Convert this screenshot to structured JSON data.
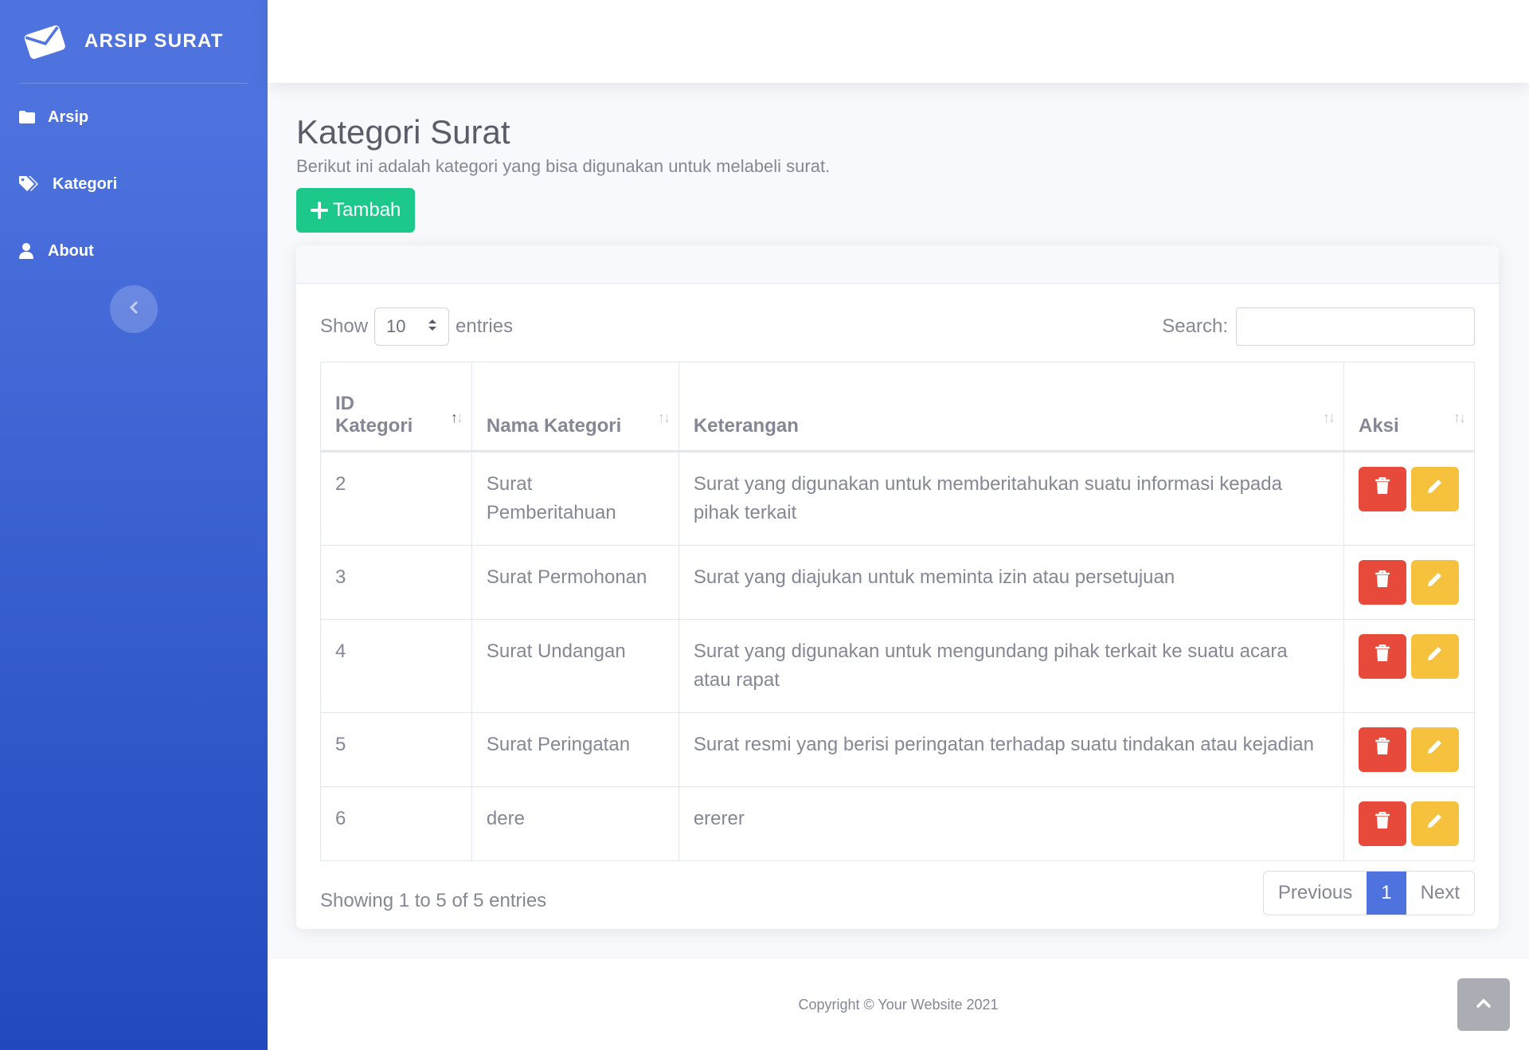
{
  "app": {
    "brand": "ARSIP SURAT"
  },
  "sidebar": {
    "items": [
      {
        "label": "Arsip",
        "icon": "folder-icon"
      },
      {
        "label": "Kategori",
        "icon": "tags-icon"
      },
      {
        "label": "About",
        "icon": "user-icon"
      }
    ],
    "toggle_icon": "chevron-left-icon"
  },
  "page": {
    "title": "Kategori Surat",
    "subtitle": "Berikut ini adalah kategori yang bisa digunakan untuk melabeli surat.",
    "add_button": "Tambah"
  },
  "table_controls": {
    "show_label": "Show",
    "entries_value": "10",
    "entries_label": "entries",
    "search_label": "Search:",
    "search_value": ""
  },
  "table": {
    "columns": [
      {
        "line1": "ID",
        "line2": "Kategori"
      },
      {
        "line1": "",
        "line2": "Nama Kategori"
      },
      {
        "line1": "",
        "line2": "Keterangan"
      },
      {
        "line1": "",
        "line2": "Aksi"
      }
    ],
    "rows": [
      {
        "id": "2",
        "nama": "Surat Pemberitahuan",
        "keterangan": "Surat yang digunakan untuk memberitahukan suatu informasi kepada pihak terkait"
      },
      {
        "id": "3",
        "nama": "Surat Permohonan",
        "keterangan": "Surat yang diajukan untuk meminta izin atau persetujuan"
      },
      {
        "id": "4",
        "nama": "Surat Undangan",
        "keterangan": "Surat yang digunakan untuk mengundang pihak terkait ke suatu acara atau rapat"
      },
      {
        "id": "5",
        "nama": "Surat Peringatan",
        "keterangan": "Surat resmi yang berisi peringatan terhadap suatu tindakan atau kejadian"
      },
      {
        "id": "6",
        "nama": "dere",
        "keterangan": "ererer"
      }
    ]
  },
  "pagination": {
    "info": "Showing 1 to 5 of 5 entries",
    "previous": "Previous",
    "current": "1",
    "next": "Next"
  },
  "footer": {
    "copyright": "Copyright © Your Website 2021"
  },
  "colors": {
    "sidebar_top": "#4e73df",
    "sidebar_bottom": "#224abe",
    "success": "#1cc88a",
    "danger": "#e74a3b",
    "warning": "#f6c23e",
    "primary": "#4e73df"
  }
}
